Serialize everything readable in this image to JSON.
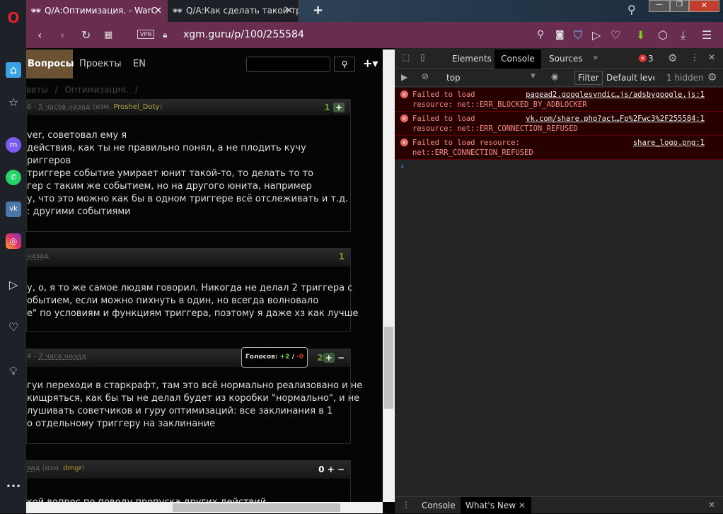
{
  "tabs": [
    {
      "label": "Q/A:Оптимизация. - WarC",
      "active": true
    },
    {
      "label": "Q/A:Как сделать такой три",
      "active": false
    }
  ],
  "address": {
    "vpn": "VPN",
    "url": "xgm.guru/p/100/255584"
  },
  "site_nav": {
    "items": [
      "Вопросы",
      "Проекты",
      "EN"
    ],
    "breadcrumb": [
      "веты",
      "/",
      "Оптимизация.",
      "/"
    ]
  },
  "posts": [
    {
      "meta": "6 - ",
      "time": "5 часов назад",
      "edited_prefix": " (изм. ",
      "editor": "Proshel_Doty",
      "edited_suffix": ")",
      "votes": "1",
      "lines": [
        "ver, советовал ему я",
        " действия, как ты не правильно понял, а не плодить кучу",
        "риггеров",
        " триггере событие умирает юнит такой-то, то делать то то",
        "гер с таким же событием, но на другого юнита, например",
        "у, что это можно как бы в одном триггере всё отслеживать и т.д.",
        ": другими событиями"
      ]
    },
    {
      "meta": "",
      "time": "назад",
      "votes": "1",
      "lines": [
        "у, о, я то же самое людям говорил. Никогда не делал 2 триггера с",
        "обытием, если можно пихнуть в один, но всегда волновало",
        "e\" по условиям и функциям триггера, поэтому я даже хз как лучше"
      ]
    },
    {
      "meta": "4 - ",
      "time": "2 часа назад",
      "votes": "2",
      "tooltip": {
        "label": "Голосов:",
        "plus": "+2",
        "sep": "/",
        "minus": "-0"
      },
      "lines": [
        "гуи переходи в старкрафт, там это всё нормально реализовано и не",
        "кищряться, как бы ты не делал будет из коробки \"нормально\", и не",
        "лушивать советчиков и гуру оптимизаций: все заклинания в 1",
        "о отдельному триггеру на заклинание"
      ]
    },
    {
      "meta": "",
      "time": "зад",
      "edited_prefix": " (изм. ",
      "editor": "dmgr",
      "edited_suffix": ")",
      "votes": "0",
      "lines": [
        "кой вопрос по поводу пропуска других действий."
      ]
    }
  ],
  "devtools": {
    "tabs": [
      "Elements",
      "Console",
      "Sources",
      "»"
    ],
    "error_count": "3",
    "context": "top",
    "filter": "Filter",
    "level": "Default levels",
    "hidden": "1 hidden",
    "messages": [
      {
        "text1": "Failed to load",
        "text2": "resource: net::ERR_BLOCKED_BY_ADBLOCKER",
        "source": "pagead2.googlesyndic…js/adsbygoogle.js:1"
      },
      {
        "text1": "Failed to load",
        "text2": "resource: net::ERR_CONNECTION_REFUSED",
        "source": "vk.com/share.php?act…Fp%2Fwc3%2F255584:1"
      },
      {
        "text1": "Failed to load resource:",
        "text2": "net::ERR_CONNECTION_REFUSED",
        "source": "share_logo.png:1"
      }
    ],
    "drawer_tabs": [
      "Console",
      "What's New"
    ]
  },
  "colors": {
    "address_bar": "#692d4f",
    "accent_green": "#6a9a2a",
    "error_bg": "#290000"
  }
}
